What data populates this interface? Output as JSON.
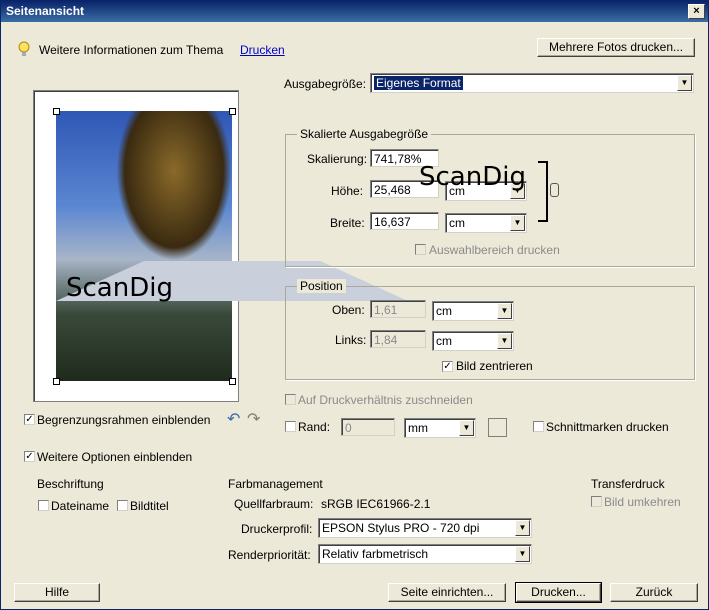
{
  "window": {
    "title": "Seitenansicht",
    "close_glyph": "×"
  },
  "info": {
    "text": "Weitere Informationen zum Thema",
    "link": "Drucken"
  },
  "buttons": {
    "multi_photos": "Mehrere Fotos drucken...",
    "help": "Hilfe",
    "page_setup": "Seite einrichten...",
    "print": "Drucken...",
    "back": "Zurück"
  },
  "output_size": {
    "label": "Ausgabegröße:",
    "value": "Eigenes Format"
  },
  "scaled": {
    "legend": "Skalierte Ausgabegröße",
    "scaling_label": "Skalierung:",
    "scaling_value": "741,78%",
    "height_label": "Höhe:",
    "height_value": "25,468",
    "height_unit": "cm",
    "width_label": "Breite:",
    "width_value": "16,637",
    "width_unit": "cm",
    "print_selection": "Auswahlbereich drucken"
  },
  "position": {
    "legend": "Position",
    "top_label": "Oben:",
    "top_value": "1,61",
    "top_unit": "cm",
    "left_label": "Links:",
    "left_value": "1,84",
    "left_unit": "cm",
    "center_label": "Bild zentrieren",
    "center_checked": true
  },
  "crop": {
    "label": "Auf Druckverhältnis zuschneiden"
  },
  "border": {
    "label": "Rand:",
    "value": "0",
    "unit": "mm"
  },
  "crop_marks": {
    "label": "Schnittmarken drucken"
  },
  "bounding_box": {
    "label": "Begrenzungsrahmen einblenden",
    "checked": true
  },
  "more_options": {
    "label": "Weitere Optionen einblenden",
    "checked": true
  },
  "caption": {
    "title": "Beschriftung",
    "filename": "Dateiname",
    "image_title": "Bildtitel"
  },
  "color_management": {
    "title": "Farbmanagement",
    "source_label": "Quellfarbraum:",
    "source_value": "sRGB IEC61966-2.1",
    "printer_label": "Druckerprofil:",
    "printer_value": "EPSON Stylus PRO - 720 dpi",
    "intent_label": "Renderpriorität:",
    "intent_value": "Relativ farbmetrisch"
  },
  "transfer": {
    "title": "Transferdruck",
    "invert": "Bild umkehren"
  },
  "watermark": "ScanDig",
  "icons": {
    "info": "lightbulb-icon",
    "rotate_left": "rotate-left-icon",
    "rotate_right": "rotate-right-icon",
    "link": "chain-link-icon"
  }
}
